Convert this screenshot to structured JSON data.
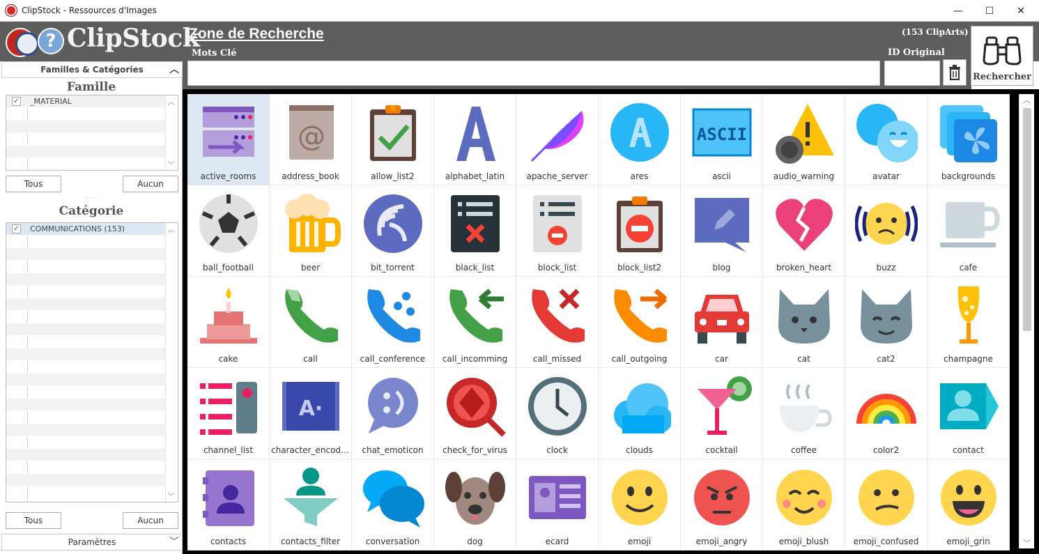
{
  "window": {
    "title": "ClipStock - Ressources d'Images",
    "minimize": "—",
    "maximize": "☐",
    "close": "✕"
  },
  "logo": {
    "text": "ClipStock"
  },
  "search": {
    "zone_title": "Zone de Recherche",
    "count": "(153 ClipArts)",
    "keywords_label": "Mots Clé",
    "id_label": "ID Original",
    "button_label": "Rechercher"
  },
  "sidebar": {
    "header": "Familles & Catégories",
    "famille_title": "Famille",
    "famille_items": [
      {
        "label": "_MATERIAL",
        "checked": true
      }
    ],
    "categorie_title": "Catégorie",
    "categorie_items": [
      {
        "label": "COMMUNICATIONS (153)",
        "checked": true
      }
    ],
    "btn_all": "Tous",
    "btn_none": "Aucun",
    "params": "Paramètres"
  },
  "icons": [
    {
      "label": "active_rooms",
      "icon": "rooms-icon",
      "selected": true
    },
    {
      "label": "address_book",
      "icon": "at-book-icon"
    },
    {
      "label": "allow_list2",
      "icon": "clipboard-check-icon"
    },
    {
      "label": "alphabet_latin",
      "icon": "letter-a-icon"
    },
    {
      "label": "apache_server",
      "icon": "feather-icon"
    },
    {
      "label": "ares",
      "icon": "ares-icon"
    },
    {
      "label": "ascii",
      "icon": "ascii-icon"
    },
    {
      "label": "audio_warning",
      "icon": "warning-icon"
    },
    {
      "label": "avatar",
      "icon": "smiley-pair-icon"
    },
    {
      "label": "backgrounds",
      "icon": "backgrounds-icon"
    },
    {
      "label": "ball_football",
      "icon": "football-icon"
    },
    {
      "label": "beer",
      "icon": "beer-icon"
    },
    {
      "label": "bit_torrent",
      "icon": "torrent-icon"
    },
    {
      "label": "black_list",
      "icon": "black-list-icon"
    },
    {
      "label": "block_list",
      "icon": "block-list-icon"
    },
    {
      "label": "block_list2",
      "icon": "block-clipboard-icon"
    },
    {
      "label": "blog",
      "icon": "blog-icon"
    },
    {
      "label": "broken_heart",
      "icon": "broken-heart-icon"
    },
    {
      "label": "buzz",
      "icon": "buzz-icon"
    },
    {
      "label": "cafe",
      "icon": "cup-icon"
    },
    {
      "label": "cake",
      "icon": "cake-icon"
    },
    {
      "label": "call",
      "icon": "phone-icon"
    },
    {
      "label": "call_conference",
      "icon": "phone-conference-icon"
    },
    {
      "label": "call_incomming",
      "icon": "phone-incoming-icon"
    },
    {
      "label": "call_missed",
      "icon": "phone-missed-icon"
    },
    {
      "label": "call_outgoing",
      "icon": "phone-outgoing-icon"
    },
    {
      "label": "car",
      "icon": "car-icon"
    },
    {
      "label": "cat",
      "icon": "cat-icon"
    },
    {
      "label": "cat2",
      "icon": "cat-smile-icon"
    },
    {
      "label": "champagne",
      "icon": "champagne-icon"
    },
    {
      "label": "channel_list",
      "icon": "channel-list-icon"
    },
    {
      "label": "character_encoding",
      "icon": "encoding-icon"
    },
    {
      "label": "chat_emoticon",
      "icon": "chat-emoticon-icon"
    },
    {
      "label": "check_for_virus",
      "icon": "virus-check-icon"
    },
    {
      "label": "clock",
      "icon": "clock-icon"
    },
    {
      "label": "clouds",
      "icon": "clouds-icon"
    },
    {
      "label": "cocktail",
      "icon": "cocktail-icon"
    },
    {
      "label": "coffee",
      "icon": "coffee-icon"
    },
    {
      "label": "color2",
      "icon": "rainbow-icon"
    },
    {
      "label": "contact",
      "icon": "contact-icon"
    },
    {
      "label": "contacts",
      "icon": "contacts-book-icon"
    },
    {
      "label": "contacts_filter",
      "icon": "contacts-filter-icon"
    },
    {
      "label": "conversation",
      "icon": "conversation-icon"
    },
    {
      "label": "dog",
      "icon": "dog-icon"
    },
    {
      "label": "ecard",
      "icon": "ecard-icon"
    },
    {
      "label": "emoji",
      "icon": "emoji-icon"
    },
    {
      "label": "emoji_angry",
      "icon": "emoji-angry-icon"
    },
    {
      "label": "emoji_blush",
      "icon": "emoji-blush-icon"
    },
    {
      "label": "emoji_confused",
      "icon": "emoji-confused-icon"
    },
    {
      "label": "emoji_grin",
      "icon": "emoji-grin-icon"
    }
  ]
}
